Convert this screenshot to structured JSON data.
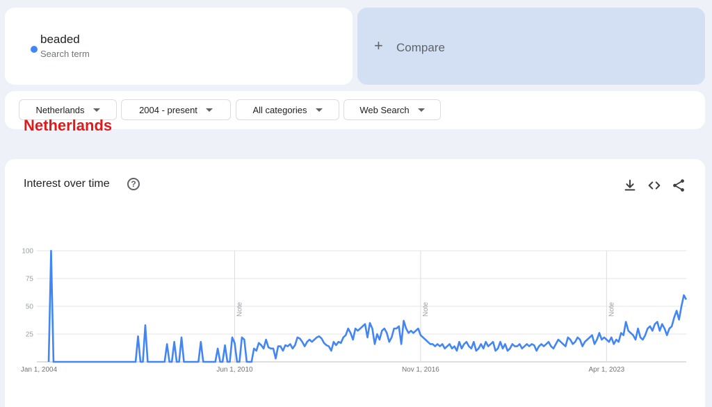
{
  "search_term": {
    "name": "beaded",
    "subtitle": "Search term",
    "color": "#4285f4"
  },
  "compare": {
    "label": "Compare"
  },
  "filters": {
    "region": "Netherlands",
    "time": "2004 - present",
    "category": "All categories",
    "property": "Web Search"
  },
  "overlay_label": "Netherlands",
  "chart_section": {
    "title": "Interest over time"
  },
  "icons": [
    "help-icon",
    "download-icon",
    "embed-icon",
    "share-icon"
  ],
  "chart_data": {
    "type": "line",
    "title": "Interest over time",
    "xlabel": "",
    "ylabel": "",
    "ylim": [
      0,
      100
    ],
    "y_ticks": [
      "100",
      "75",
      "50",
      "25"
    ],
    "x_ticks": [
      "Jan 1, 2004",
      "Jun 1, 2010",
      "Nov 1, 2016",
      "Apr 1, 2023"
    ],
    "notes": [
      "Note",
      "Note",
      "Note"
    ],
    "series_color": "#4285f4",
    "grid": true,
    "x_start": "2004-01",
    "x_step": "1 month",
    "series": [
      {
        "values": [
          0,
          100,
          0,
          0,
          0,
          0,
          0,
          0,
          0,
          0,
          0,
          0,
          0,
          0,
          0,
          0,
          0,
          0,
          0,
          0,
          0,
          0,
          0,
          0,
          0,
          0,
          0,
          0,
          0,
          0,
          0,
          0,
          0,
          0,
          0,
          0,
          0,
          23,
          0,
          0,
          33,
          0,
          0,
          0,
          0,
          0,
          0,
          0,
          0,
          16,
          0,
          0,
          18,
          0,
          0,
          22,
          0,
          0,
          0,
          0,
          0,
          0,
          0,
          18,
          0,
          0,
          0,
          0,
          0,
          0,
          12,
          0,
          0,
          15,
          0,
          0,
          22,
          17,
          0,
          0,
          22,
          20,
          0,
          0,
          0,
          12,
          10,
          17,
          15,
          12,
          20,
          13,
          12,
          12,
          3,
          14,
          14,
          10,
          15,
          14,
          16,
          12,
          15,
          22,
          21,
          18,
          14,
          18,
          20,
          18,
          20,
          22,
          23,
          21,
          17,
          15,
          14,
          10,
          18,
          15,
          18,
          17,
          22,
          24,
          30,
          26,
          20,
          30,
          28,
          30,
          32,
          34,
          22,
          35,
          30,
          16,
          25,
          20,
          28,
          30,
          26,
          18,
          22,
          30,
          30,
          32,
          16,
          37,
          30,
          26,
          28,
          26,
          28,
          30,
          24,
          22,
          20,
          18,
          16,
          16,
          14,
          16,
          14,
          16,
          12,
          14,
          16,
          12,
          14,
          10,
          18,
          12,
          16,
          18,
          14,
          12,
          18,
          10,
          12,
          16,
          12,
          18,
          14,
          16,
          18,
          10,
          12,
          18,
          12,
          16,
          10,
          12,
          16,
          14,
          14,
          16,
          12,
          14,
          16,
          14,
          16,
          15,
          10,
          14,
          16,
          14,
          16,
          18,
          14,
          12,
          16,
          20,
          18,
          16,
          14,
          22,
          20,
          16,
          18,
          22,
          20,
          14,
          18,
          20,
          22,
          24,
          16,
          20,
          26,
          20,
          22,
          20,
          18,
          22,
          16,
          20,
          18,
          26,
          24,
          36,
          28,
          26,
          24,
          20,
          30,
          22,
          20,
          24,
          30,
          32,
          28,
          34,
          36,
          28,
          34,
          30,
          24,
          30,
          32,
          40,
          46,
          38,
          50,
          60,
          56
        ]
      }
    ]
  }
}
